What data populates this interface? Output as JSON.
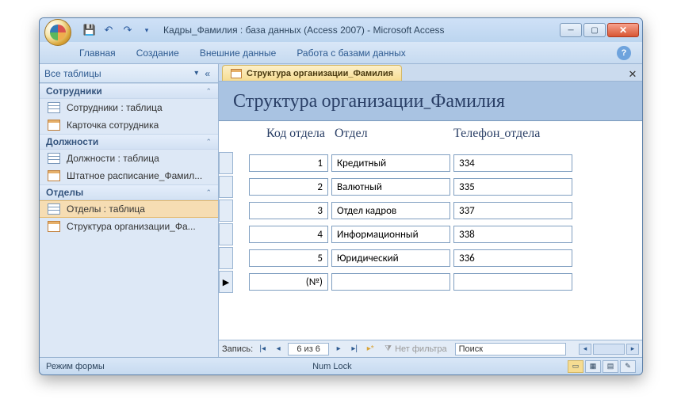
{
  "window": {
    "title": "Кадры_Фамилия : база данных (Access 2007)  -  Microsoft Access"
  },
  "ribbon": {
    "tabs": [
      "Главная",
      "Создание",
      "Внешние данные",
      "Работа с базами данных"
    ]
  },
  "nav": {
    "title": "Все таблицы",
    "groups": [
      {
        "title": "Сотрудники",
        "items": [
          {
            "icon": "table",
            "label": "Сотрудники : таблица"
          },
          {
            "icon": "form",
            "label": "Карточка сотрудника"
          }
        ]
      },
      {
        "title": "Должности",
        "items": [
          {
            "icon": "table",
            "label": "Должности : таблица"
          },
          {
            "icon": "form",
            "label": "Штатное расписание_Фамил..."
          }
        ]
      },
      {
        "title": "Отделы",
        "items": [
          {
            "icon": "table",
            "label": "Отделы : таблица",
            "selected": true
          },
          {
            "icon": "form",
            "label": "Структура организации_Фа..."
          }
        ]
      }
    ]
  },
  "doc": {
    "tab_label": "Структура организации_Фамилия",
    "form_title": "Структура организации_Фамилия",
    "columns": [
      "Код отдела",
      "Отдел",
      "Телефон_отдела"
    ],
    "rows": [
      {
        "id": "1",
        "dept": "Кредитный",
        "phone": "334"
      },
      {
        "id": "2",
        "dept": "Валютный",
        "phone": "335"
      },
      {
        "id": "3",
        "dept": "Отдел кадров",
        "phone": "337"
      },
      {
        "id": "4",
        "dept": "Информационный",
        "phone": "338"
      },
      {
        "id": "5",
        "dept": "Юридический",
        "phone": "336"
      }
    ],
    "new_row_placeholder": "(№)"
  },
  "recnav": {
    "label": "Запись:",
    "position": "6 из 6",
    "filter_label": "Нет фильтра",
    "search_placeholder": "Поиск"
  },
  "status": {
    "mode": "Режим формы",
    "numlock": "Num Lock"
  }
}
